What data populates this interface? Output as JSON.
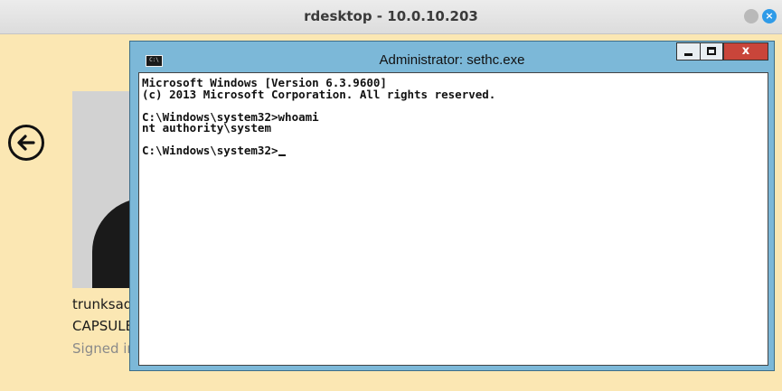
{
  "outer_window": {
    "title": "rdesktop - 10.0.10.203"
  },
  "lock_screen": {
    "user_name": "trunksadr",
    "user_domain": "CAPSULE",
    "status": "Signed in remotely from rd..."
  },
  "cmd_window": {
    "title": "Administrator: sethc.exe",
    "icon_label": "C:\\",
    "lines": [
      "Microsoft Windows [Version 6.3.9600]",
      "(c) 2013 Microsoft Corporation. All rights reserved.",
      "",
      "C:\\Windows\\system32>whoami",
      "nt authority\\system",
      "",
      "C:\\Windows\\system32>"
    ],
    "close_label": "x"
  },
  "colors": {
    "lock_background": "#fbe7b3",
    "cmd_frame": "#7cb8d8",
    "close_button": "#c9453a"
  }
}
